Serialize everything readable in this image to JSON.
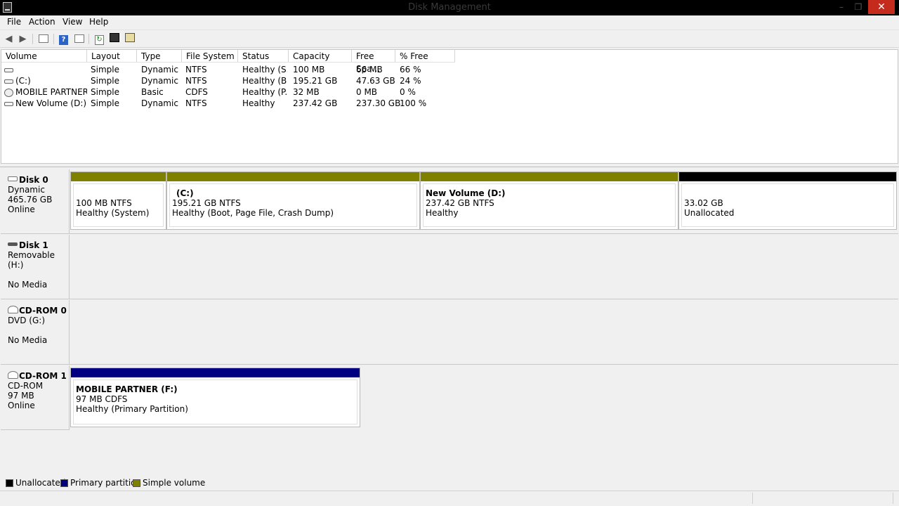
{
  "window": {
    "title": "Disk Management",
    "minimize": "–",
    "maximize": "❐",
    "close": "✕"
  },
  "menu": [
    "File",
    "Action",
    "View",
    "Help"
  ],
  "toolbar": [
    "back-icon",
    "forward-icon",
    "show-hide-console-tree-icon",
    "help-icon",
    "show-hide-action-pane-icon",
    "refresh-icon",
    "properties-icon",
    "rescan-disks-icon"
  ],
  "volume_list": {
    "columns": [
      "Volume",
      "Layout",
      "Type",
      "File System",
      "Status",
      "Capacity",
      "Free Spa...",
      "% Free"
    ],
    "rows": [
      {
        "icon": "volume-icon",
        "volume": "",
        "layout": "Simple",
        "type": "Dynamic",
        "fs": "NTFS",
        "status": "Healthy (S...",
        "capacity": "100 MB",
        "free": "66 MB",
        "pct": "66 %"
      },
      {
        "icon": "volume-icon",
        "volume": "(C:)",
        "layout": "Simple",
        "type": "Dynamic",
        "fs": "NTFS",
        "status": "Healthy (B...",
        "capacity": "195.21 GB",
        "free": "47.63 GB",
        "pct": "24 %"
      },
      {
        "icon": "cd-volume-icon",
        "volume": "MOBILE PARTNER...",
        "layout": "Simple",
        "type": "Basic",
        "fs": "CDFS",
        "status": "Healthy (P...",
        "capacity": "32 MB",
        "free": "0 MB",
        "pct": "0 %"
      },
      {
        "icon": "volume-icon",
        "volume": "New Volume (D:)",
        "layout": "Simple",
        "type": "Dynamic",
        "fs": "NTFS",
        "status": "Healthy",
        "capacity": "237.42 GB",
        "free": "237.30 GB",
        "pct": "100 %"
      }
    ]
  },
  "disks": [
    {
      "name": "Disk 0",
      "line1": "Dynamic",
      "line2": "465.76 GB",
      "line3": "Online",
      "partitions": [
        {
          "name": "",
          "size": "100 MB NTFS",
          "status": "Healthy (System)",
          "color": "#808000"
        },
        {
          "name": "(C:)",
          "size": "195.21 GB NTFS",
          "status": "Healthy (Boot, Page File, Crash Dump)",
          "color": "#808000"
        },
        {
          "name": "New Volume  (D:)",
          "size": "237.42 GB NTFS",
          "status": "Healthy",
          "color": "#808000"
        },
        {
          "name": "",
          "size": "33.02 GB",
          "status": "Unallocated",
          "color": "#000000"
        }
      ]
    },
    {
      "name": "Disk 1",
      "line1": "Removable (H:)",
      "line2": "",
      "line3": "No Media",
      "partitions": []
    },
    {
      "name": "CD-ROM 0",
      "line1": "DVD (G:)",
      "line2": "",
      "line3": "No Media",
      "partitions": []
    },
    {
      "name": "CD-ROM 1",
      "line1": "CD-ROM",
      "line2": "97 MB",
      "line3": "Online",
      "partitions": [
        {
          "name": "MOBILE PARTNER  (F:)",
          "size": "97 MB CDFS",
          "status": "Healthy (Primary Partition)",
          "color": "#000080"
        }
      ]
    }
  ],
  "legend": [
    {
      "label": "Unallocated",
      "color": "#000000"
    },
    {
      "label": "Primary partition",
      "color": "#000080"
    },
    {
      "label": "Simple volume",
      "color": "#808000"
    }
  ]
}
